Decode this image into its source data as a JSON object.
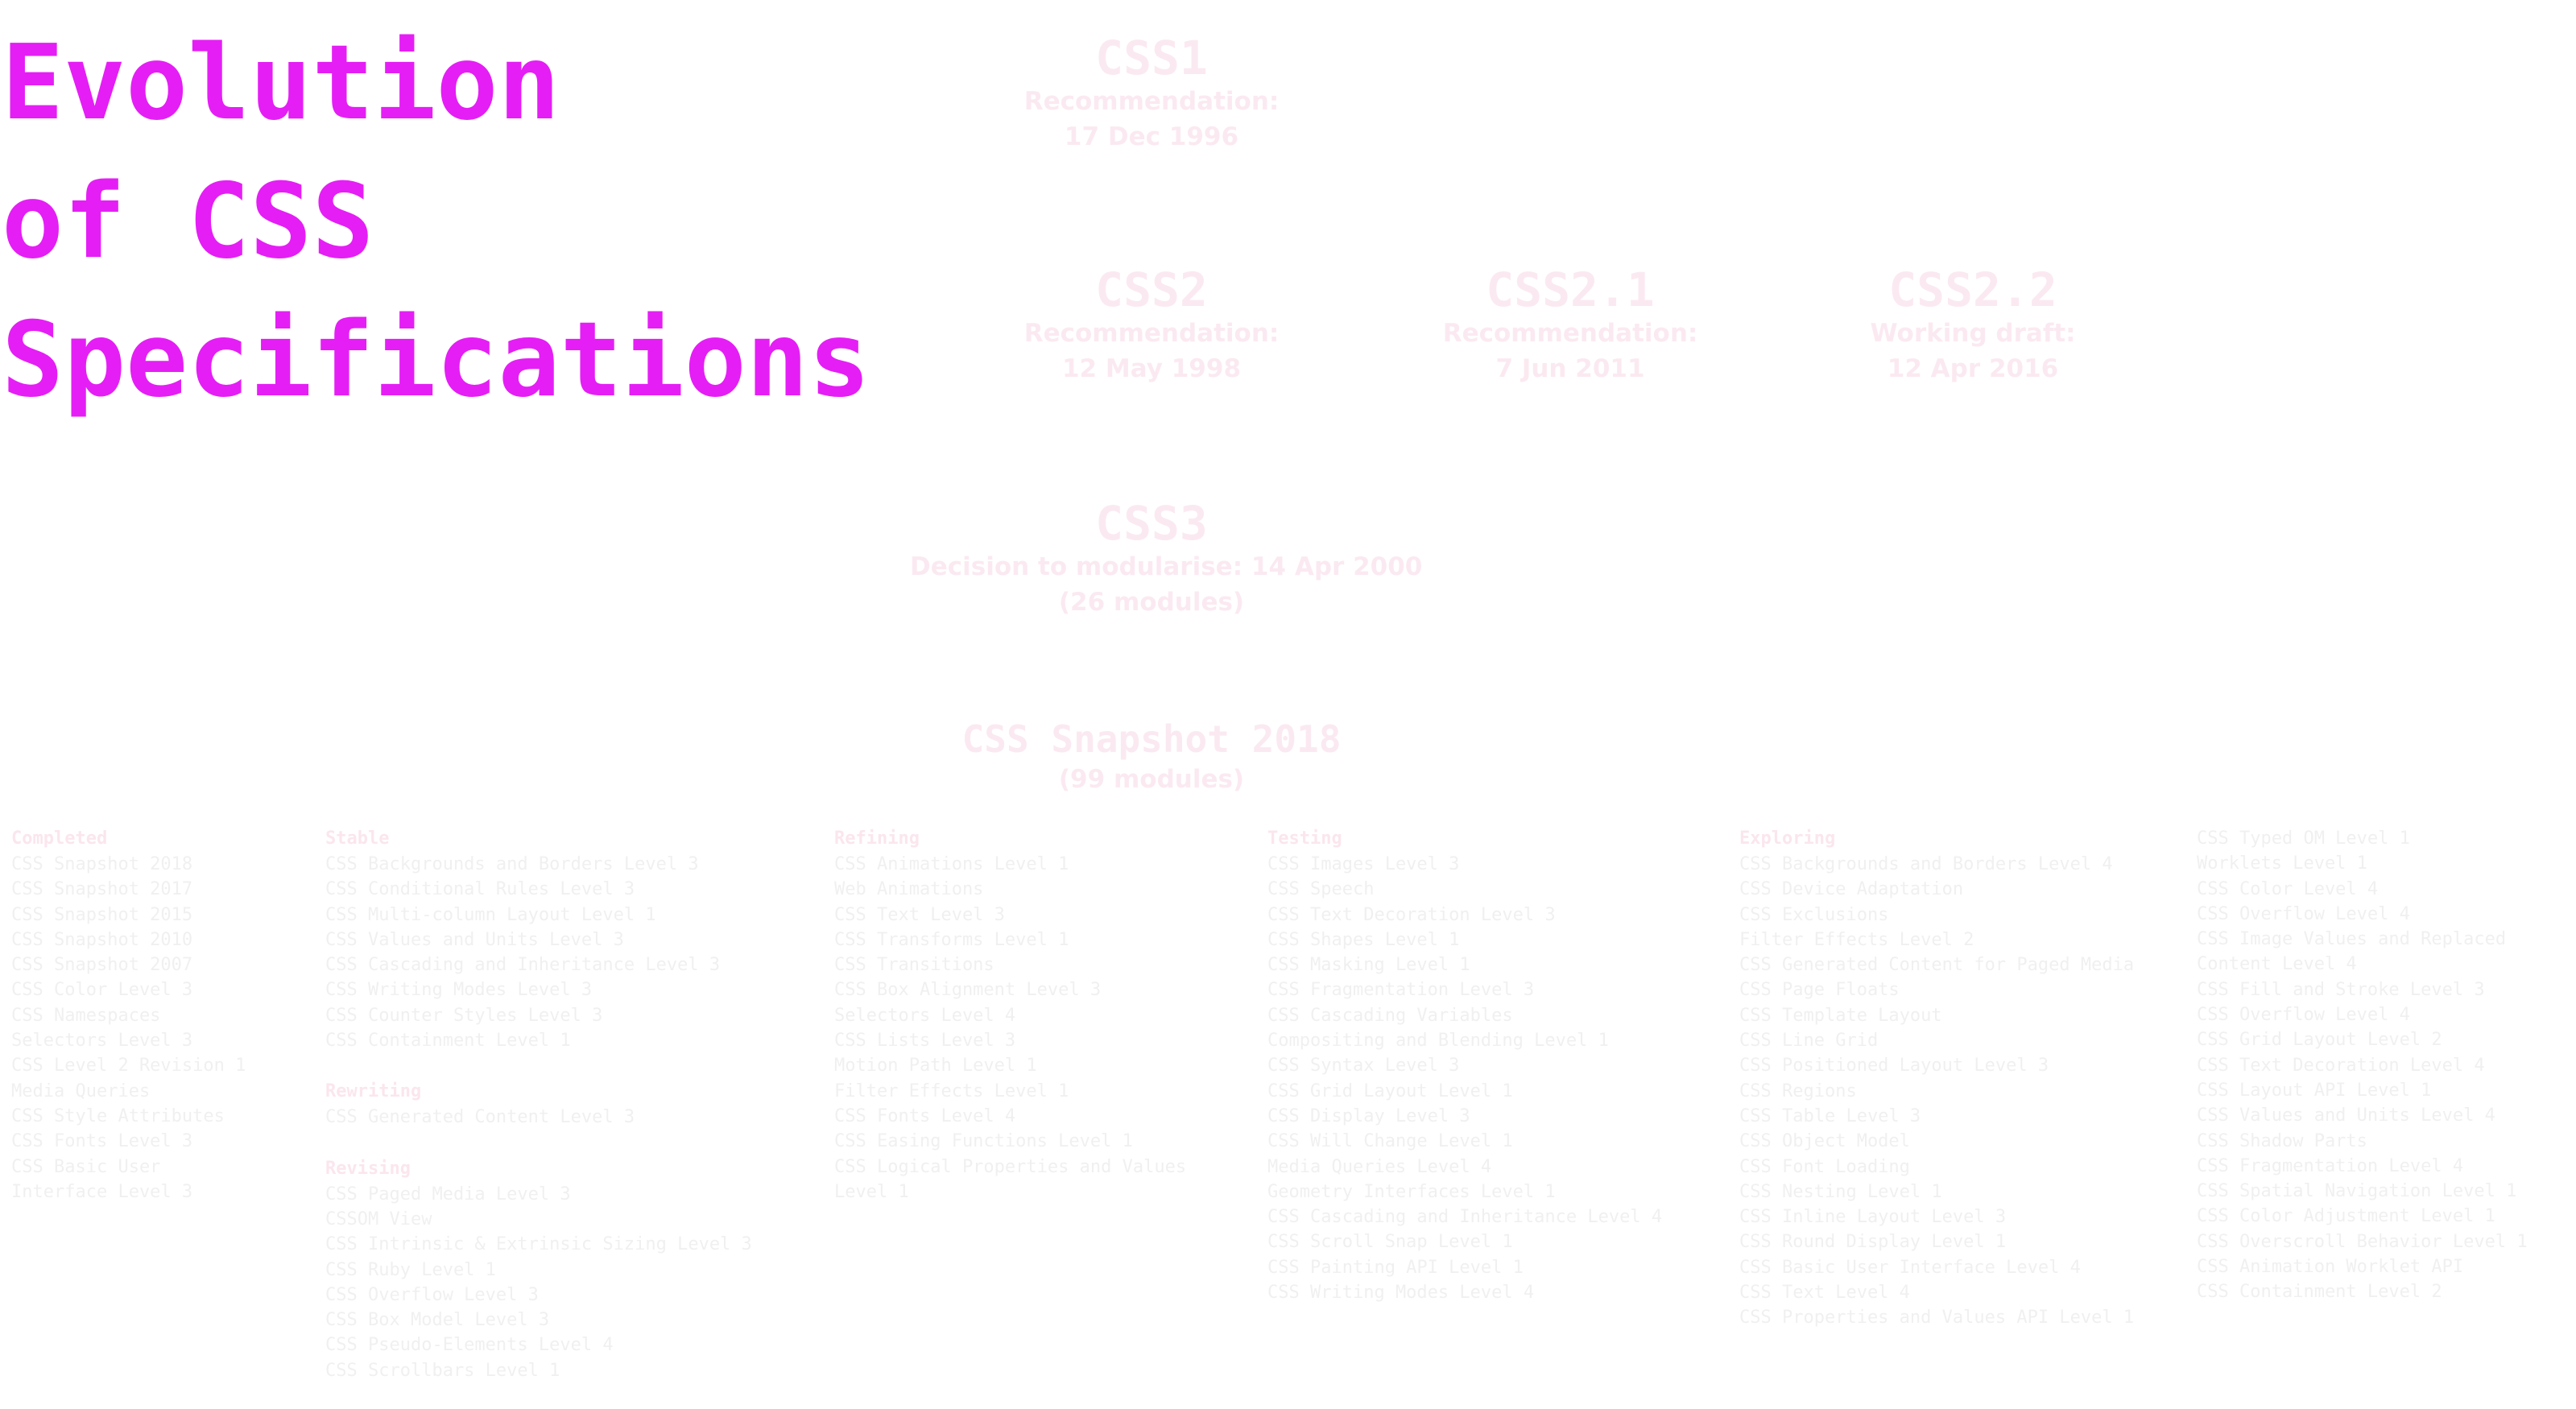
{
  "title": {
    "lines": [
      "Evolution",
      "of CSS",
      "Specifications"
    ]
  },
  "specs": {
    "css1": {
      "name": "CSS1",
      "status": "Recommendation:",
      "date": "17 Dec 1996"
    },
    "css2": {
      "name": "CSS2",
      "status": "Recommendation:",
      "date": "12 May 1998"
    },
    "css21": {
      "name": "CSS2.1",
      "status": "Recommendation:",
      "date": "7 Jun 2011"
    },
    "css22": {
      "name": "CSS2.2",
      "status": "Working draft:",
      "date": "12 Apr 2016"
    },
    "css3": {
      "name": "CSS3",
      "status": "Decision to modularise: 14 Apr 2000",
      "date": "(26 modules)"
    },
    "snapshot": {
      "name": "CSS Snapshot 2018",
      "date": "(99 modules)"
    }
  },
  "columns": [
    {
      "groups": [
        {
          "heading": "Completed",
          "items": [
            "CSS Snapshot 2018",
            "CSS Snapshot 2017",
            "CSS Snapshot 2015",
            "CSS Snapshot 2010",
            "CSS Snapshot 2007",
            "CSS Color Level 3",
            "CSS Namespaces",
            "Selectors Level 3",
            "CSS Level 2 Revision 1",
            "Media Queries",
            "CSS Style Attributes",
            "CSS Fonts Level 3",
            "CSS Basic User",
            "Interface Level 3"
          ]
        }
      ]
    },
    {
      "groups": [
        {
          "heading": "Stable",
          "items": [
            "CSS Backgrounds and Borders Level 3",
            "CSS Conditional Rules Level 3",
            "CSS Multi-column Layout Level 1",
            "CSS Values and Units Level 3",
            "CSS Cascading and Inheritance Level 3",
            "CSS Writing Modes Level 3",
            "CSS Counter Styles Level 3",
            "CSS Containment Level 1"
          ]
        },
        {
          "heading": "Rewriting",
          "items": [
            "CSS Generated Content Level 3"
          ]
        },
        {
          "heading": "Revising",
          "items": [
            "CSS Paged Media Level 3",
            "CSSOM View",
            "CSS Intrinsic & Extrinsic Sizing Level 3",
            "CSS Ruby Level 1",
            "CSS Overflow Level 3",
            "CSS Box Model Level 3",
            "CSS Pseudo-Elements Level 4",
            "CSS Scrollbars Level 1"
          ]
        }
      ]
    },
    {
      "groups": [
        {
          "heading": "Refining",
          "items": [
            "CSS Animations Level 1",
            "Web Animations",
            "CSS Text Level 3",
            "CSS Transforms Level 1",
            "CSS Transitions",
            "CSS Box Alignment Level 3",
            "Selectors Level 4",
            "CSS Lists Level 3",
            "Motion Path Level 1",
            "Filter Effects Level 1",
            "CSS Fonts Level 4",
            "CSS Easing Functions Level 1",
            "CSS Logical Properties and Values Level 1"
          ]
        }
      ]
    },
    {
      "groups": [
        {
          "heading": "Testing",
          "items": [
            "CSS Images Level 3",
            "CSS Speech",
            "CSS Text Decoration Level 3",
            "CSS Shapes Level 1",
            "CSS Masking Level 1",
            "CSS Fragmentation Level 3",
            "CSS Cascading Variables",
            "Compositing and Blending Level 1",
            "CSS Syntax Level 3",
            "CSS Grid Layout Level 1",
            "CSS Display Level 3",
            "CSS Will Change Level 1",
            "Media Queries Level 4",
            "Geometry Interfaces Level 1",
            "CSS Cascading and Inheritance Level 4",
            "CSS Scroll Snap Level 1",
            "CSS Painting API Level 1",
            "CSS Writing Modes Level 4"
          ]
        }
      ]
    },
    {
      "groups": [
        {
          "heading": "Exploring",
          "items": [
            "CSS Backgrounds and Borders Level 4",
            "CSS Device Adaptation",
            "CSS Exclusions",
            "Filter Effects Level 2",
            "CSS Generated Content for Paged Media",
            "CSS Page Floats",
            "CSS Template Layout",
            "CSS Line Grid",
            "CSS Positioned Layout Level 3",
            "CSS Regions",
            "CSS Table Level 3",
            "CSS Object Model",
            "CSS Font Loading",
            "CSS Nesting Level 1",
            "CSS Inline Layout Level 3",
            "CSS Round Display Level 1",
            "CSS Basic User Interface Level 4",
            "CSS Text Level 4",
            "CSS Properties and Values API Level 1"
          ]
        }
      ]
    },
    {
      "groups": [
        {
          "heading": "",
          "items": [
            "CSS Typed OM Level 1",
            "Worklets Level 1",
            "CSS Color Level 4",
            "CSS Overflow Level 4",
            "CSS Image Values and Replaced Content Level 4",
            "CSS Fill and Stroke Level 3",
            "CSS Overflow Level 4",
            "CSS Grid Layout Level 2",
            "CSS Text Decoration Level 4",
            "CSS Layout API Level 1",
            "CSS Values and Units Level 4",
            "CSS Shadow Parts",
            "CSS Fragmentation Level 4",
            "CSS Spatial Navigation Level 1",
            "CSS Color Adjustment Level 1",
            "CSS Overscroll Behavior Level 1",
            "CSS Animation Worklet API",
            "CSS Containment Level 2"
          ]
        }
      ]
    }
  ]
}
